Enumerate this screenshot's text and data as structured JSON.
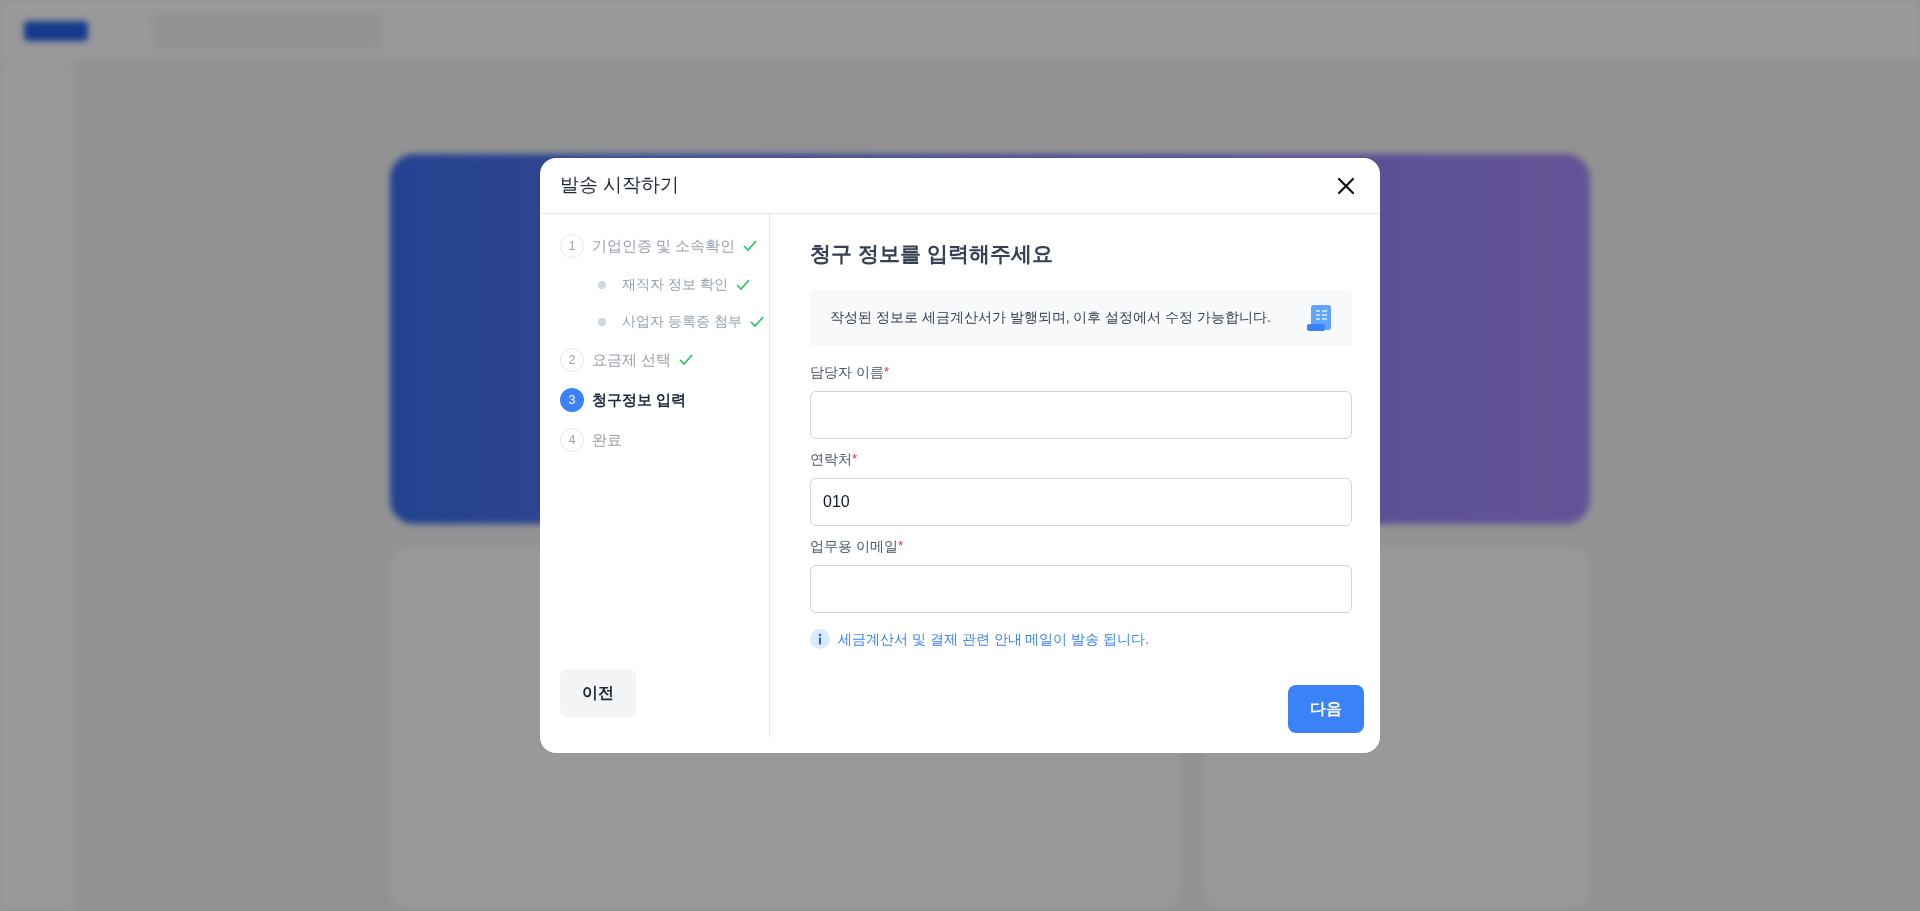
{
  "dialog": {
    "title": "발송 시작하기",
    "steps": [
      {
        "number": "1",
        "label": "기업인증 및 소속확인",
        "checked": true,
        "selected": false,
        "children": [
          {
            "label": "재직자 정보 확인",
            "checked": true
          },
          {
            "label": "사업자 등록증 첨부",
            "checked": true
          }
        ]
      },
      {
        "number": "2",
        "label": "요금제 선택",
        "checked": true,
        "selected": false
      },
      {
        "number": "3",
        "label": "청구정보 입력",
        "checked": false,
        "selected": true
      },
      {
        "number": "4",
        "label": "완료",
        "checked": false,
        "selected": false
      }
    ],
    "heading": "청구 정보를 입력해주세요",
    "notice": "작성된 정보로 세금계산서가 발행되며, 이후 설정에서 수정 가능합니다.",
    "fields": [
      {
        "label": "담당자 이름",
        "required_mark": "*"
      },
      {
        "label": "연락처",
        "required_mark": "*",
        "value": "010"
      },
      {
        "label": "업무용 이메일",
        "required_mark": "*"
      }
    ],
    "hint": "세금계산서 및 결제 관련 안내 메일이 발송 됩니다.",
    "buttons": {
      "back": "이전",
      "next": "다음"
    }
  }
}
